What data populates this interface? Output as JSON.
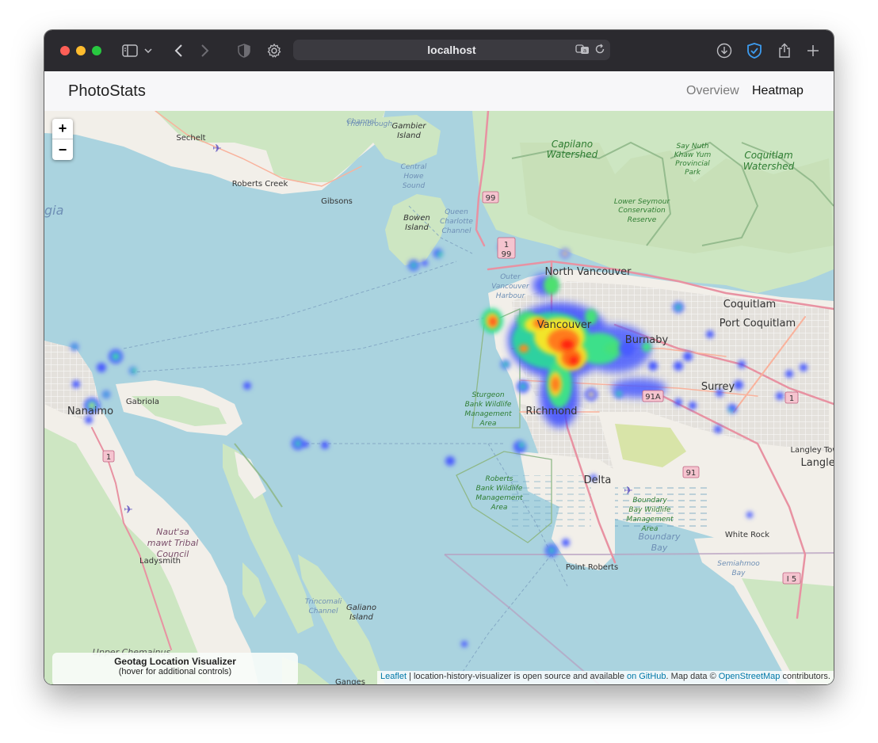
{
  "browser": {
    "address": "localhost"
  },
  "navbar": {
    "brand": "PhotoStats",
    "links": [
      "Overview",
      "Heatmap"
    ],
    "active": "Heatmap"
  },
  "map": {
    "zoom_in": "+",
    "zoom_out": "−",
    "labels": {
      "sechelt": "Sechelt",
      "gambier": [
        "Gambier",
        "Island"
      ],
      "thornbrough": [
        "Thornbrough",
        "Channel"
      ],
      "capilano": [
        "Capilano",
        "Watershed"
      ],
      "say_nuth": [
        "Say Nuth",
        "Khaw Yum",
        "Provincial",
        "Park"
      ],
      "coquitlam_ws": [
        "Coquitlam",
        "Watershed"
      ],
      "roberts_creek": "Roberts Creek",
      "gibsons": "Gibsons",
      "howe_sound": [
        "Central",
        "Howe",
        "Sound"
      ],
      "bowen": [
        "Bowen",
        "Island"
      ],
      "queen_charlotte": [
        "Queen",
        "Charlotte",
        "Channel"
      ],
      "lower_seymour": [
        "Lower Seymour",
        "Conservation",
        "Reserve"
      ],
      "georgia": "gia",
      "north_vancouver": "North Vancouver",
      "outer_harbour": [
        "Outer",
        "Vancouver",
        "Harbour"
      ],
      "coquitlam": "Coquitlam",
      "port_coquitlam": "Port Coquitlam",
      "vancouver": "Vancouver",
      "burnaby": "Burnaby",
      "surrey": "Surrey",
      "gabriola": "Gabriola",
      "nanaimo": "Nanaimo",
      "sturgeon": [
        "Sturgeon",
        "Bank Wildlife",
        "Management",
        "Area"
      ],
      "richmond": "Richmond",
      "langley_town": "Langley Tow",
      "langley": "Langley",
      "roberts_bank": [
        "Roberts",
        "Bank Wildlife",
        "Management",
        "Area"
      ],
      "delta": "Delta",
      "boundary_bay_wma": [
        "Boundary",
        "Bay Wildlife",
        "Management",
        "Area"
      ],
      "boundary_bay": [
        "Boundary",
        "Bay"
      ],
      "nautsa": [
        "Naut'sa",
        "mawt Tribal",
        "Council"
      ],
      "ladysmith": "Ladysmith",
      "white_rock": "White Rock",
      "point_roberts": "Point Roberts",
      "semiahmoo": [
        "Semiahmoo",
        "Bay"
      ],
      "trincomali": [
        "Trincomali",
        "Channel"
      ],
      "galiano": [
        "Galiano",
        "Island"
      ],
      "upper_chemainus": "Upper Chemainus",
      "ganges": "Ganges"
    },
    "shields": {
      "hwy99_a": "99",
      "hwy1_a": "1",
      "hwy99_b": "99",
      "hwy91a": "91A",
      "hwy1_b": "1",
      "hwy91": "91",
      "hwy1_c": "1",
      "i5": "I 5"
    },
    "colors": {
      "water": "#aad3df",
      "land": "#f2efe9",
      "forest": "#cde6c2",
      "park": "#c8facc",
      "urban": "#dcdad9",
      "motorway": "#e892a2",
      "boundary": "#8fb889"
    }
  },
  "visualizer": {
    "title": "Geotag Location Visualizer",
    "subtitle": "(hover for additional controls)"
  },
  "attribution": {
    "leaflet": "Leaflet",
    "sep1": " | location-history-visualizer is open source and available ",
    "github": "on GitHub",
    "sep2": ". Map data © ",
    "osm": "OpenStreetMap",
    "tail": " contributors."
  }
}
